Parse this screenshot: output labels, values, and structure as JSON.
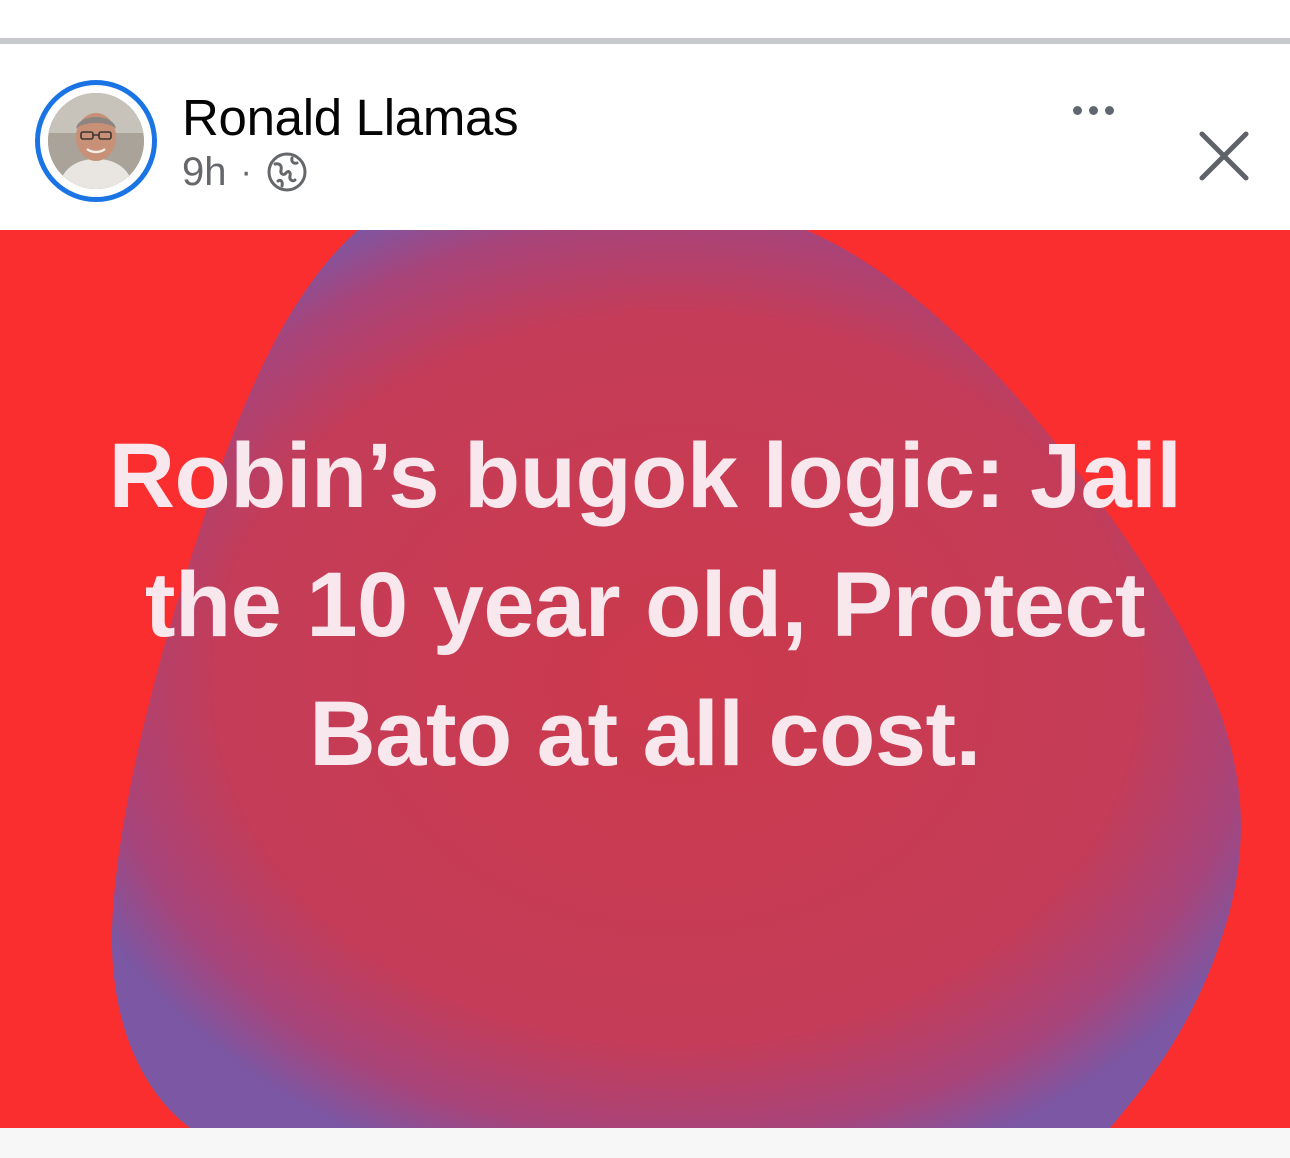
{
  "post": {
    "author_name": "Ronald Llamas",
    "timestamp": "9h",
    "separator": "·",
    "privacy_icon": "globe-icon",
    "more_icon": "more-options-icon",
    "close_icon": "close-icon",
    "avatar_icon": "profile-photo",
    "body_text": "Robin’s bugok logic: Jail the 10 year old, Protect Bato at all cost.",
    "background": {
      "base_color": "#fa2e2f",
      "blob_color": "#c73a56",
      "blob_edge_color": "#7b57a4",
      "text_color": "#f8e8ee"
    }
  },
  "theme": {
    "accent": "#1b74e4",
    "name_color": "#050505",
    "meta_color": "#65676b"
  }
}
